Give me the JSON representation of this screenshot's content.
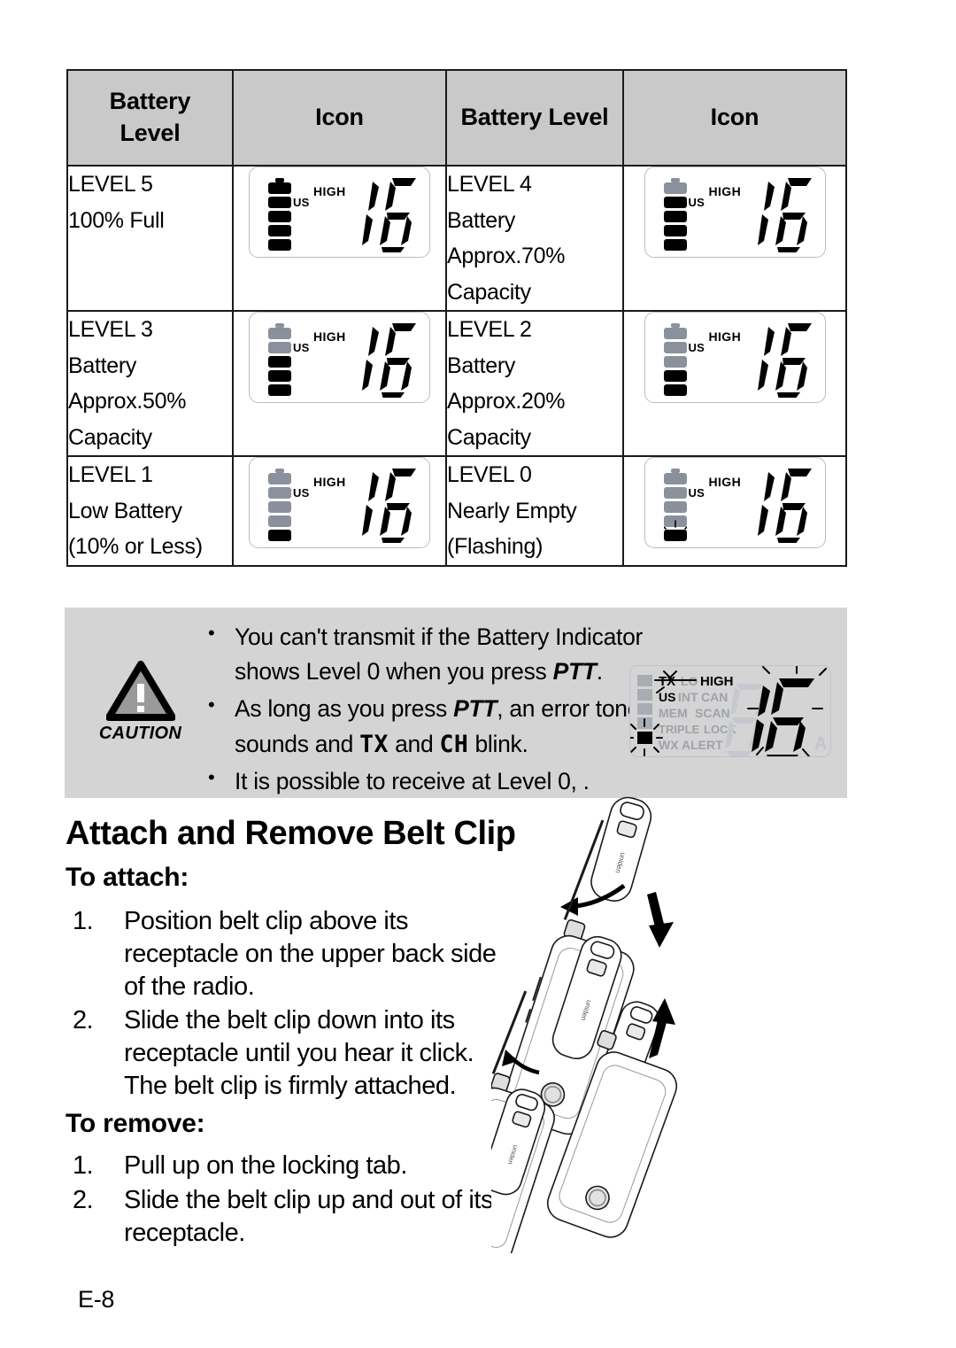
{
  "table": {
    "headers": [
      "Battery Level",
      "Icon",
      "Battery Level",
      "Icon"
    ],
    "header_left_line1": "Battery",
    "header_left_line2": "Level",
    "rows": [
      {
        "left": {
          "title": "LEVEL 5",
          "lines": [
            "100%  Full"
          ],
          "icon": {
            "segments_filled": 5,
            "segments_total": 5,
            "high": "HIGH",
            "us": "US",
            "digits": "16",
            "flashing": false
          }
        },
        "right": {
          "title": "LEVEL 4",
          "lines": [
            "Battery",
            "Approx.70%",
            "Capacity"
          ],
          "icon": {
            "segments_filled": 4,
            "segments_total": 5,
            "high": "HIGH",
            "us": "US",
            "digits": "16",
            "flashing": false
          }
        }
      },
      {
        "left": {
          "title": "LEVEL 3",
          "lines": [
            "Battery",
            "Approx.50%",
            "Capacity"
          ],
          "icon": {
            "segments_filled": 3,
            "segments_total": 5,
            "high": "HIGH",
            "us": "US",
            "digits": "16",
            "flashing": false
          }
        },
        "right": {
          "title": "LEVEL 2",
          "lines": [
            "Battery",
            "Approx.20%",
            "Capacity"
          ],
          "icon": {
            "segments_filled": 2,
            "segments_total": 5,
            "high": "HIGH",
            "us": "US",
            "digits": "16",
            "flashing": false
          }
        }
      },
      {
        "left": {
          "title": "LEVEL 1",
          "lines": [
            "Low Battery",
            "(10% or Less)"
          ],
          "icon": {
            "segments_filled": 1,
            "segments_total": 5,
            "high": "HIGH",
            "us": "US",
            "digits": "16",
            "flashing": false
          }
        },
        "right": {
          "title": "LEVEL 0",
          "lines": [
            "Nearly Empty",
            "(Flashing)"
          ],
          "icon": {
            "segments_filled": 1,
            "segments_total": 5,
            "high": "HIGH",
            "us": "US",
            "digits": "16",
            "flashing": true
          }
        }
      }
    ]
  },
  "caution": {
    "label": "CAUTION",
    "bullets": [
      {
        "parts": [
          {
            "t": "You can't transmit if the Battery Indicator shows Level 0 when you press ",
            "style": "normal"
          },
          {
            "t": "PTT",
            "style": "italic-bold"
          },
          {
            "t": ".",
            "style": "normal"
          }
        ]
      },
      {
        "parts": [
          {
            "t": "As long as you press ",
            "style": "normal"
          },
          {
            "t": "PTT",
            "style": "italic-bold"
          },
          {
            "t": ", an error tone sounds and ",
            "style": "normal"
          },
          {
            "t": "TX",
            "style": "dotted"
          },
          {
            "t": " and ",
            "style": "normal"
          },
          {
            "t": "CH",
            "style": "dotted"
          },
          {
            "t": " blink.",
            "style": "normal"
          }
        ]
      },
      {
        "parts": [
          {
            "t": "It is possible to receive at Level 0, .",
            "style": "normal"
          }
        ]
      }
    ],
    "lcd": {
      "digits": "16",
      "labels": [
        "TX",
        "LO",
        "HIGH",
        "US",
        "INT",
        "CAN",
        "MEM",
        "SCAN",
        "TRIPLE",
        "LOCK",
        "WX",
        "ALERT",
        "A"
      ],
      "active_labels": [
        "TX",
        "HIGH",
        "US"
      ],
      "bar_segments_total": 5,
      "bar_segments_filled": 1,
      "flashing": true
    }
  },
  "section": {
    "title": "Attach and Remove Belt Clip",
    "attach_heading": "To attach:",
    "attach_steps": [
      {
        "num": "1.",
        "text": "Position belt clip above its receptacle on the upper back side of the radio."
      },
      {
        "num": "2.",
        "text": "Slide the belt clip down into its receptacle until you hear it click. The belt clip is firmly attached."
      }
    ],
    "remove_heading": "To remove:",
    "remove_steps": [
      {
        "num": "1.",
        "text": "Pull up on the locking tab."
      },
      {
        "num": "2.",
        "text": "Slide the belt clip up and out of its receptacle."
      }
    ]
  },
  "footer": {
    "page": "E-8"
  },
  "colors": {
    "header_bg": "#c9c9c9",
    "caution_bg": "#d4d4d4",
    "segment_empty": "#8a919c",
    "segment_full": "#000000",
    "lcd_dim": "#b3b7bd",
    "border": "#1a1a1a"
  }
}
